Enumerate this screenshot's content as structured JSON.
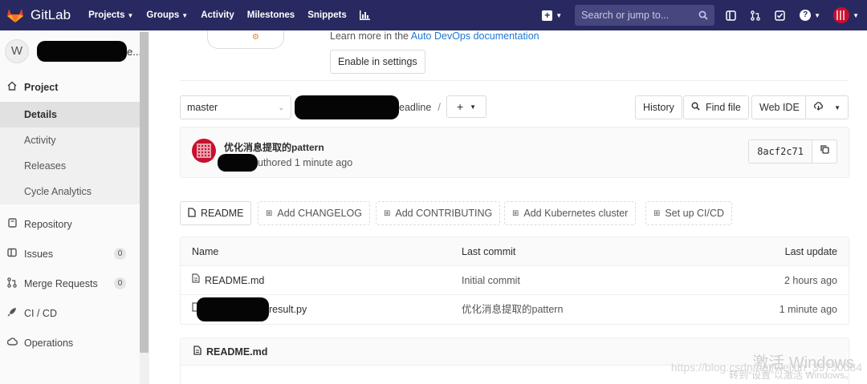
{
  "topnav": {
    "brand": "GitLab",
    "links": [
      {
        "label": "Projects",
        "dropdown": true
      },
      {
        "label": "Groups",
        "dropdown": true
      },
      {
        "label": "Activity",
        "dropdown": false
      },
      {
        "label": "Milestones",
        "dropdown": false
      },
      {
        "label": "Snippets",
        "dropdown": false
      }
    ],
    "search_placeholder": "Search or jump to..."
  },
  "sidebar": {
    "project_initial": "W",
    "project_name_suffix": "e...",
    "project_label": "Project",
    "project_sub": [
      "Details",
      "Activity",
      "Releases",
      "Cycle Analytics"
    ],
    "repository": "Repository",
    "issues": "Issues",
    "issues_count": "0",
    "merge_requests": "Merge Requests",
    "merge_requests_count": "0",
    "cicd": "CI / CD",
    "operations": "Operations"
  },
  "devops": {
    "learn_prefix": "Learn more in the",
    "learn_link": "Auto DevOps documentation",
    "enable_button": "Enable in settings"
  },
  "toolbar": {
    "branch": "master",
    "path_tail": "eadline",
    "path_sep": "/",
    "history": "History",
    "find_file": "Find file",
    "web_ide": "Web IDE"
  },
  "commit": {
    "title": "优化消息提取的pattern",
    "meta_suffix": "uthored 1 minute ago",
    "sha": "8acf2c71"
  },
  "quick_buttons": [
    "README",
    "Add CHANGELOG",
    "Add CONTRIBUTING",
    "Add Kubernetes cluster",
    "Set up CI/CD"
  ],
  "tree": {
    "headers": {
      "name": "Name",
      "last_commit": "Last commit",
      "last_update": "Last update"
    },
    "rows": [
      {
        "name": "README.md",
        "commit": "Initial commit",
        "updated": "2 hours ago"
      },
      {
        "name_suffix": "result.py",
        "commit": "优化消息提取的pattern",
        "updated": "1 minute ago"
      }
    ]
  },
  "readme": {
    "title": "README.md"
  },
  "overlay": {
    "windows_title": "激活 Windows",
    "windows_sub": "转到“设置”以激活 Windows。",
    "csdn": "https://blog.csdn.net/weixin_39750084"
  },
  "colors": {
    "nav_bg": "#292961",
    "link": "#1f78d1",
    "commit_avatar": "#c8102e"
  }
}
